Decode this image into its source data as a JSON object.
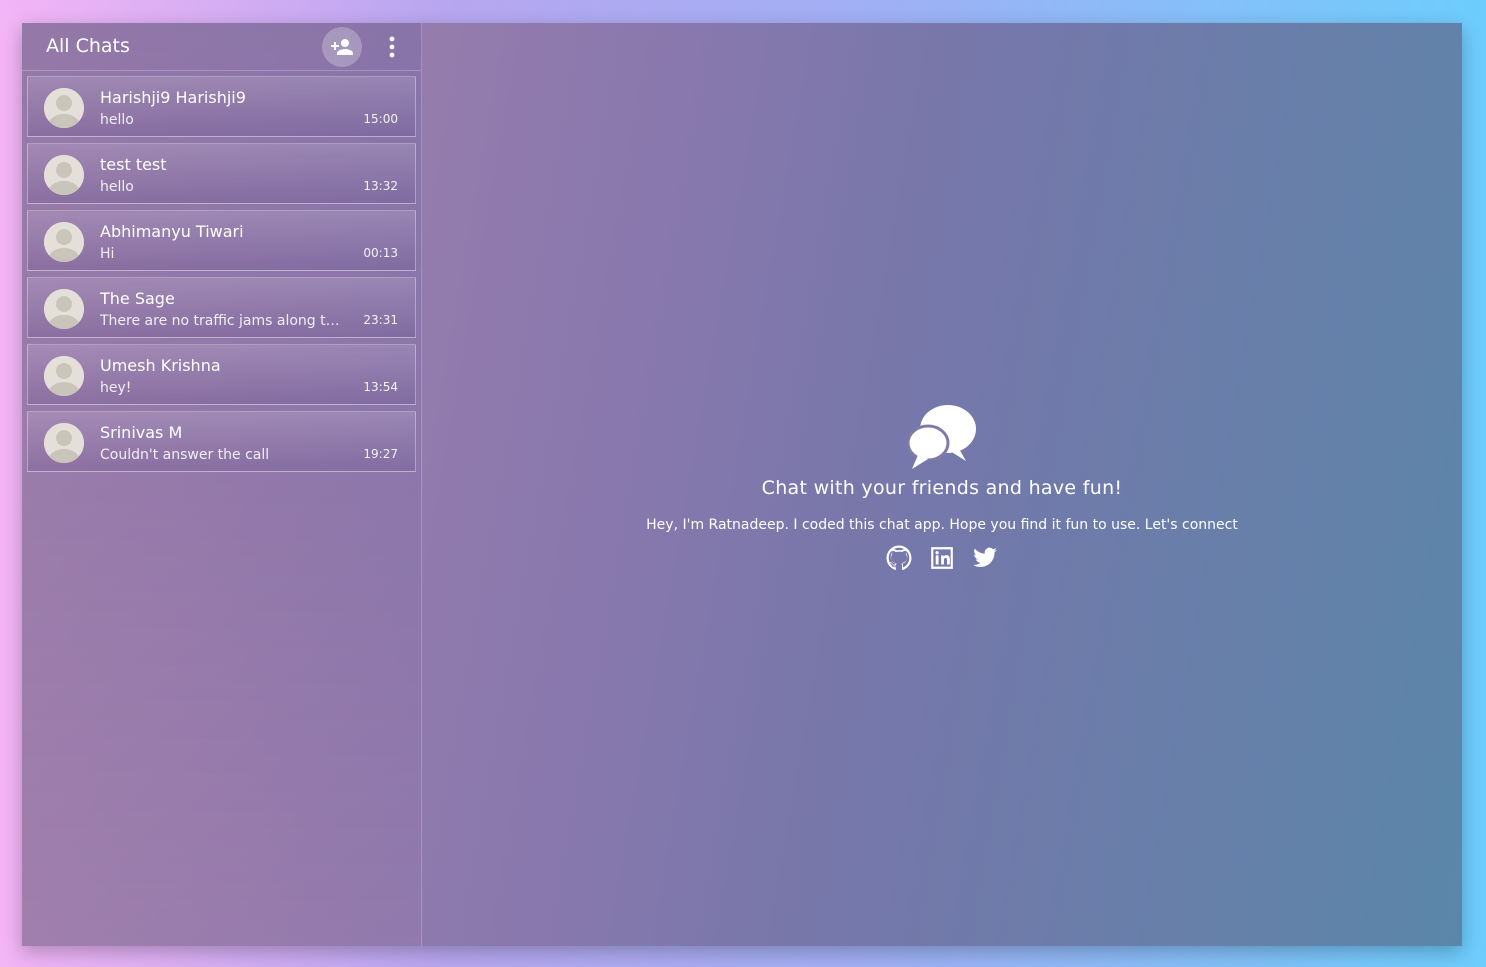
{
  "sidebar": {
    "title": "All Chats",
    "chats": [
      {
        "name": "Harishji9 Harishji9",
        "message": "hello",
        "time": "15:00"
      },
      {
        "name": "test test",
        "message": "hello",
        "time": "13:32"
      },
      {
        "name": "Abhimanyu Tiwari",
        "message": "Hi",
        "time": "00:13"
      },
      {
        "name": "The Sage",
        "message": "There are no traffic jams along the extra mile.",
        "time": "23:31"
      },
      {
        "name": "Umesh Krishna",
        "message": "hey!",
        "time": "13:54"
      },
      {
        "name": "Srinivas M",
        "message": "Couldn't answer the call",
        "time": "19:27"
      }
    ]
  },
  "main": {
    "title": "Chat with your friends and have fun!",
    "subtitle": "Hey, I'm Ratnadeep. I coded this chat app. Hope you find it fun to use. Let's connect",
    "icons": [
      "chat-bubbles-icon",
      "github-icon",
      "linkedin-icon",
      "twitter-icon"
    ]
  }
}
